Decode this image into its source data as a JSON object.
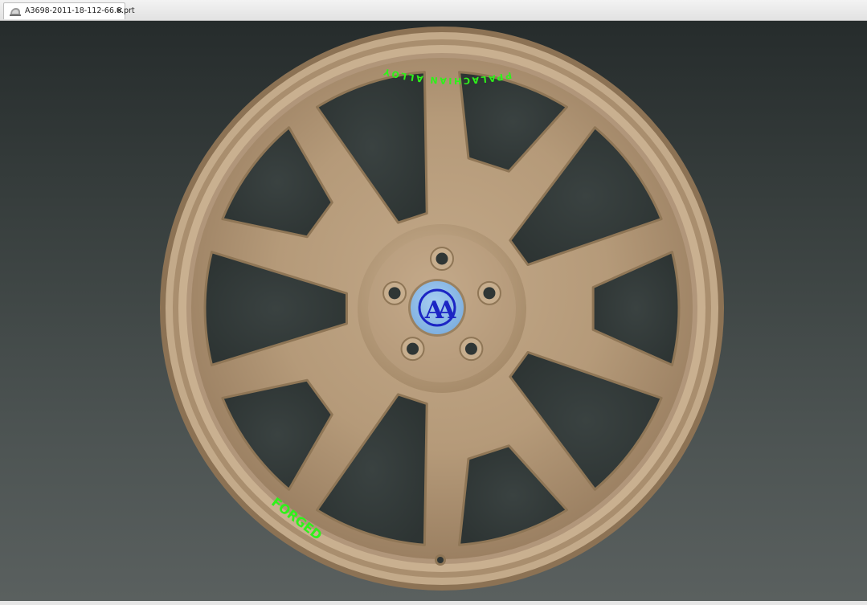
{
  "tab": {
    "title": "A3698-2011-18-112-66.6.prt",
    "close_glyph": "×",
    "icon": "part-file-icon"
  },
  "wheel": {
    "brand_text": "APPALACHIAN ALLOYS",
    "type_text": "FORGED",
    "center_cap_text": "AA",
    "spoke_count": 10,
    "lug_count": 5,
    "colors": {
      "finish": "#b69b7b",
      "finish_shadow": "#8f7656",
      "finish_highlight": "#cbb294",
      "decal": "#2ef21a",
      "cap": "#8fbde9",
      "cap_logo": "#1c25c4",
      "background_top": "#262c2c",
      "background_bottom": "#5a605f"
    }
  }
}
